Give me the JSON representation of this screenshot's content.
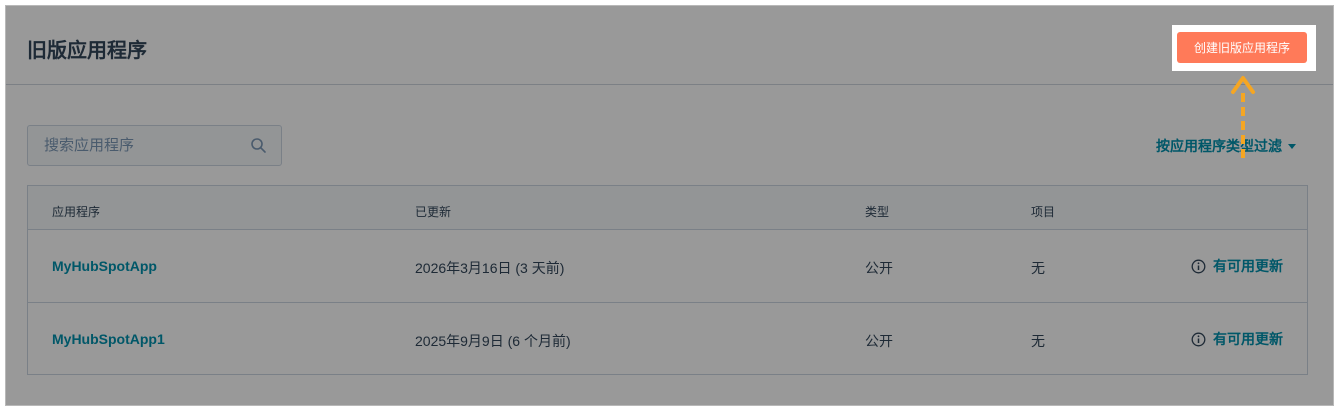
{
  "page": {
    "title": "旧版应用程序",
    "create_button_label": "创建旧版应用程序"
  },
  "search": {
    "placeholder": "搜索应用程序",
    "value": ""
  },
  "filter": {
    "label": "按应用程序类型过滤"
  },
  "table": {
    "headers": [
      "应用程序",
      "已更新",
      "类型",
      "项目"
    ],
    "rows": [
      {
        "name": "MyHubSpotApp",
        "updated": "2026年3月16日 (3 天前)",
        "type": "公开",
        "project": "无",
        "status": "有可用更新"
      },
      {
        "name": "MyHubSpotApp1",
        "updated": "2025年9月9日 (6 个月前)",
        "type": "公开",
        "project": "无",
        "status": "有可用更新"
      }
    ]
  },
  "colors": {
    "accent": "#ff7a59",
    "link": "#0091ae",
    "annotation_arrow": "#f5a623"
  },
  "icons": {
    "search": "search-icon",
    "info": "info-icon",
    "dropdown": "caret-down-icon",
    "annotation": "arrow-up-icon"
  }
}
